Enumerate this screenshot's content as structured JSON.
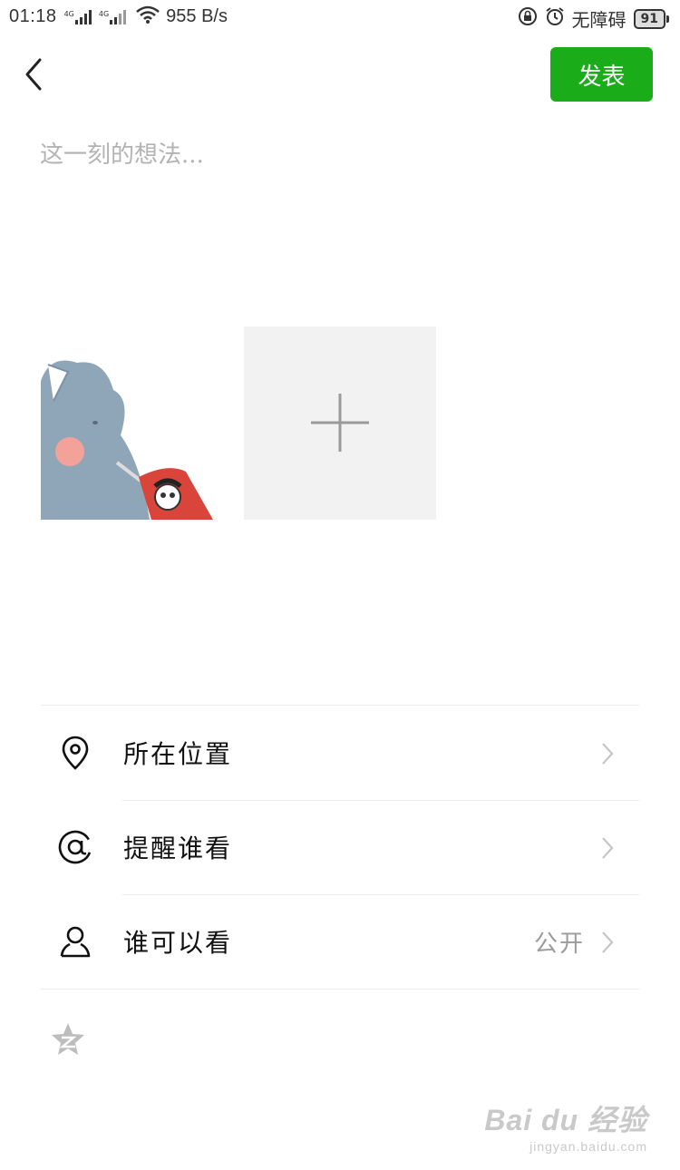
{
  "status_bar": {
    "time": "01:18",
    "signal_label_1": "4G",
    "signal_label_2": "4G",
    "net_speed": "955 B/s",
    "accessibility": "无障碍",
    "battery": "91"
  },
  "header": {
    "publish_label": "发表"
  },
  "composer": {
    "placeholder": "这一刻的想法..."
  },
  "options": {
    "location": {
      "label": "所在位置"
    },
    "mention": {
      "label": "提醒谁看"
    },
    "visibility": {
      "label": "谁可以看",
      "value": "公开"
    }
  },
  "watermark": {
    "main": "Bai du 经验",
    "sub": "jingyan.baidu.com"
  },
  "colors": {
    "accent": "#1aad19",
    "tile_bg": "#f2f2f2"
  }
}
